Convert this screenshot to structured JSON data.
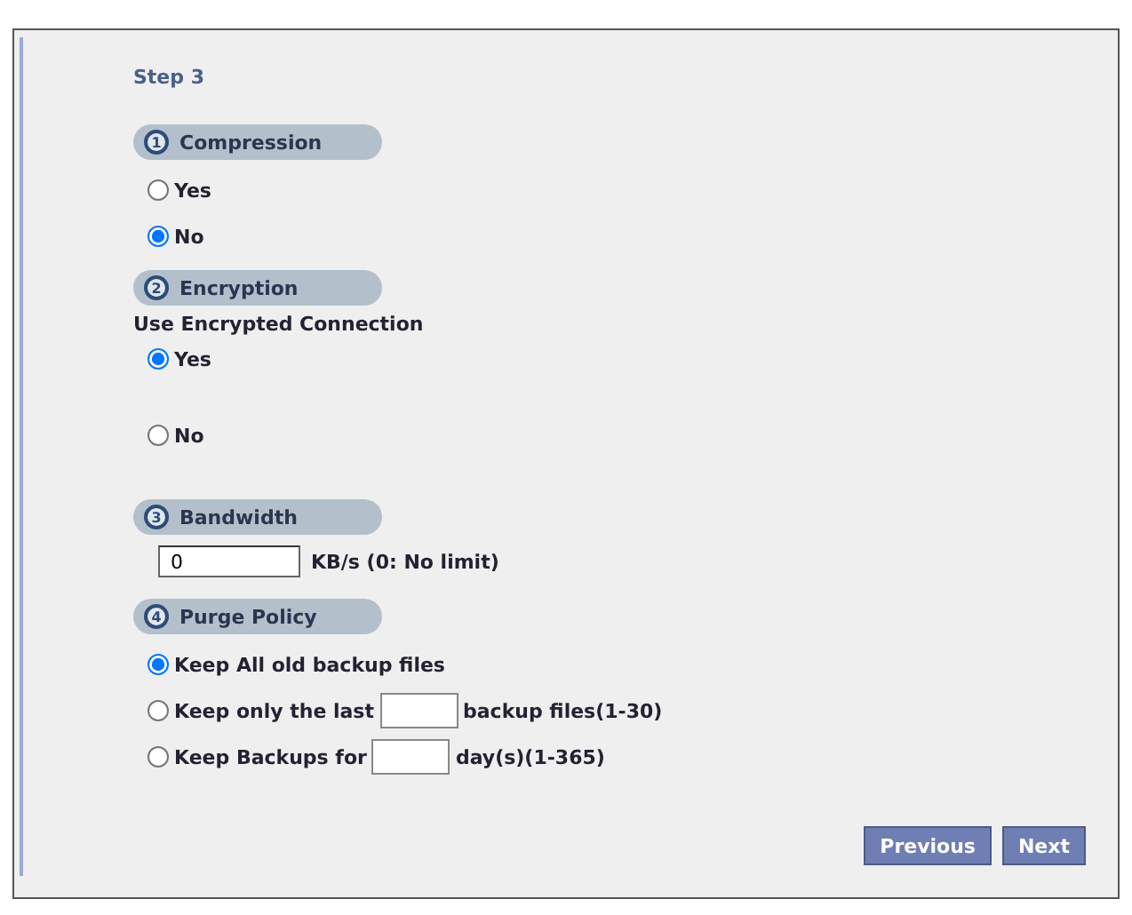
{
  "step_title": "Step 3",
  "sections": [
    {
      "number": "1",
      "title": "Compression",
      "kind": "radios",
      "options": [
        {
          "label": "Yes",
          "selected": false
        },
        {
          "label": "No",
          "selected": true
        }
      ]
    },
    {
      "number": "2",
      "title": "Encryption",
      "kind": "radios",
      "prompt": "Use Encrypted Connection",
      "spaced": true,
      "options": [
        {
          "label": "Yes",
          "selected": true
        },
        {
          "label": "No",
          "selected": false
        }
      ]
    },
    {
      "number": "3",
      "title": "Bandwidth",
      "kind": "field",
      "value": "0",
      "unit": "KB/s (0: No limit)"
    },
    {
      "number": "4",
      "title": "Purge Policy",
      "kind": "radios",
      "options": [
        {
          "label": "Keep All old backup files",
          "selected": true
        },
        {
          "before": "Keep only the last",
          "after": "backup files(1-30)",
          "selected": false
        },
        {
          "before": "Keep Backups for",
          "after": "day(s)(1-365)",
          "selected": false
        }
      ]
    }
  ],
  "buttons": [
    "Previous",
    "Next"
  ]
}
